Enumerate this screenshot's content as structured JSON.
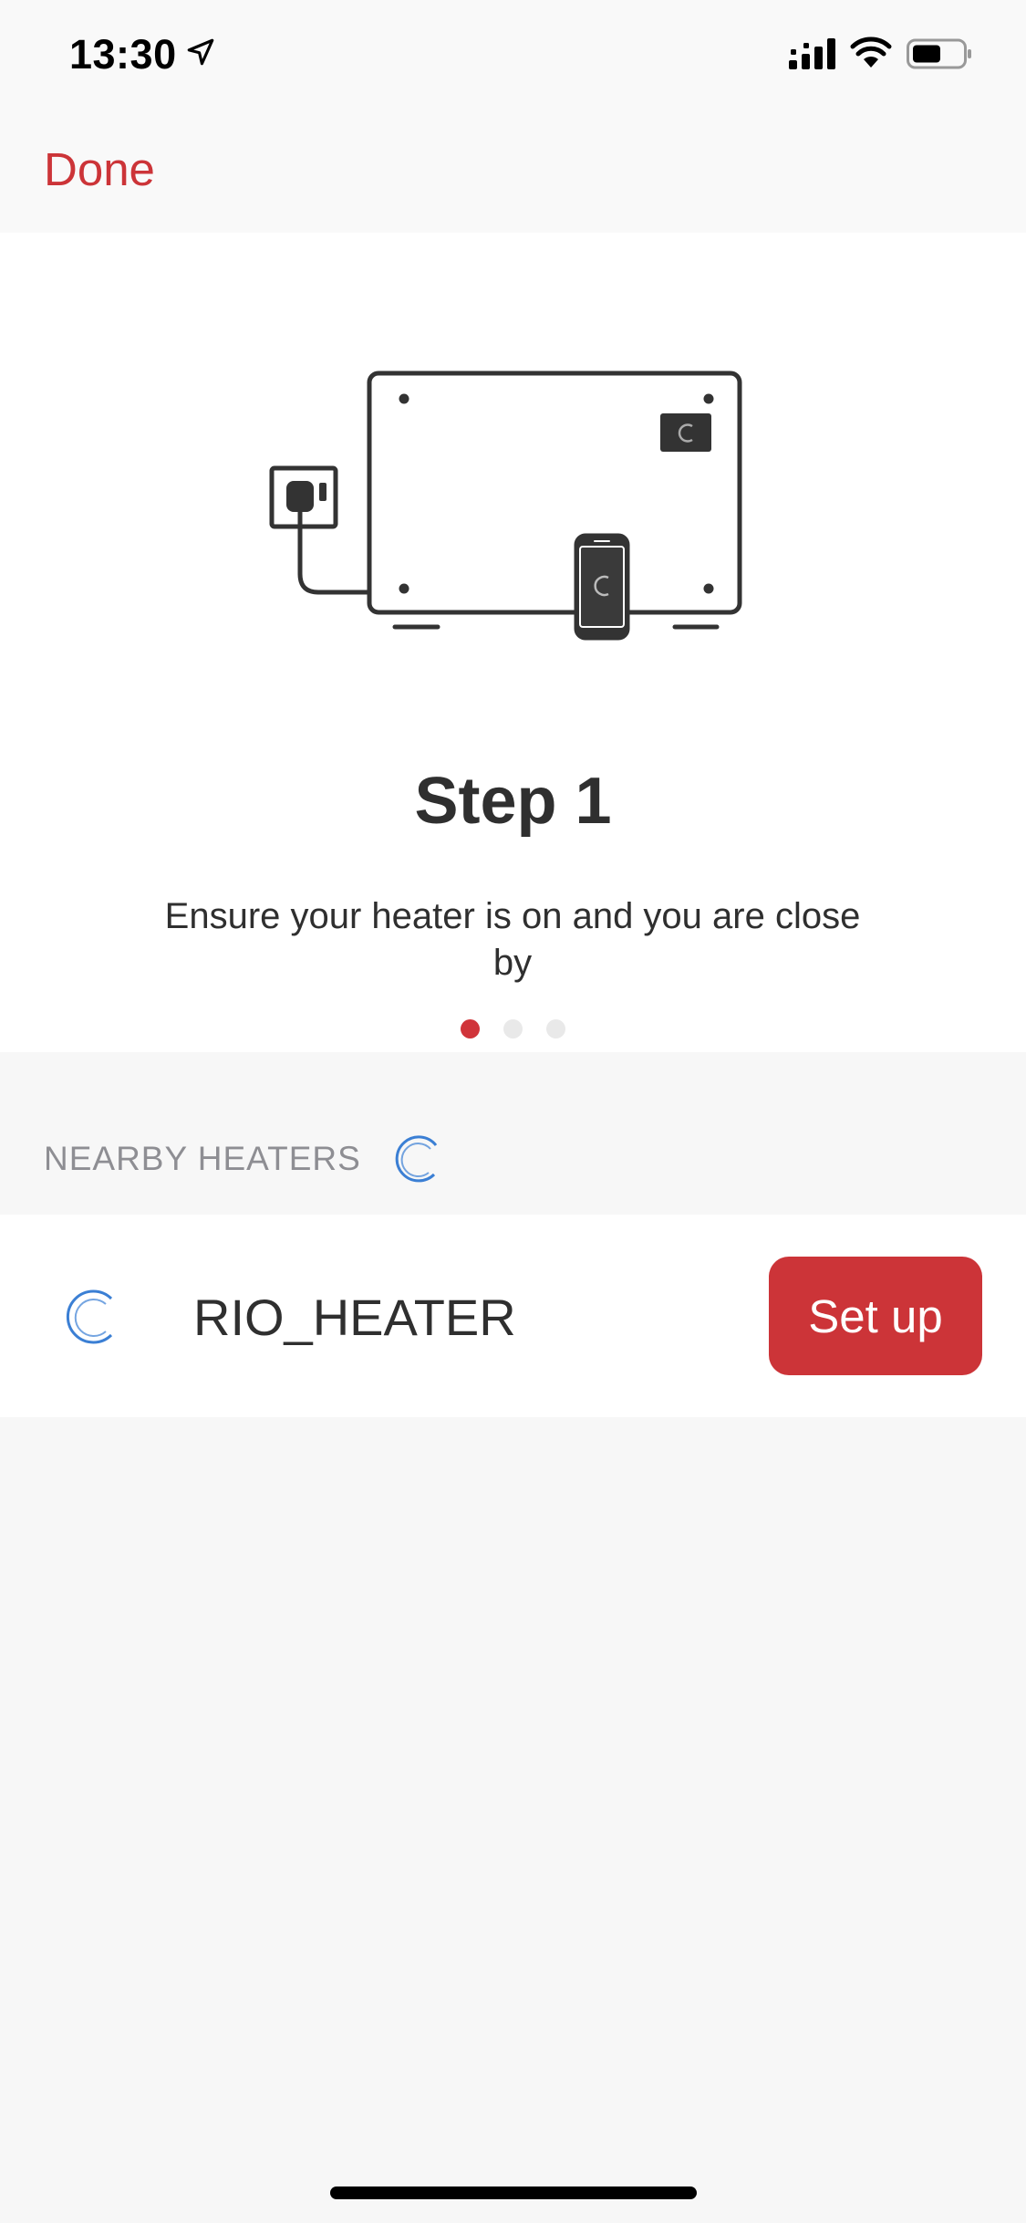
{
  "status_bar": {
    "time": "13:30",
    "icons": [
      "location-arrow-icon",
      "cellular-signal-icon",
      "wifi-icon",
      "battery-icon"
    ]
  },
  "nav": {
    "done_label": "Done"
  },
  "step": {
    "title": "Step 1",
    "description": "Ensure your heater is on and you are close by",
    "illustration_icon": "heater-plug-phone-illustration",
    "pages": 3,
    "current_page": 1
  },
  "nearby": {
    "section_title": "NEARBY HEATERS",
    "spinner_icon": "loading-spinner-icon",
    "devices": [
      {
        "name": "RIO_HEATER",
        "icon": "loading-spinner-icon",
        "action_label": "Set up"
      }
    ]
  },
  "colors": {
    "accent": "#cc3438",
    "spinner": "#3b7fd4",
    "text": "#2f2f2f",
    "section_text": "#8e8e93",
    "background": "#f7f7f7"
  }
}
